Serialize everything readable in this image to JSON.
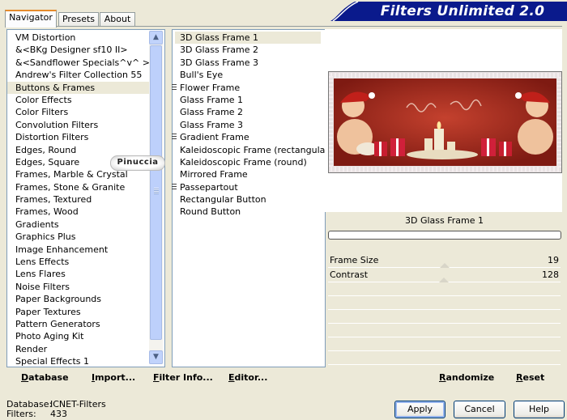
{
  "tabs": [
    "Navigator",
    "Presets",
    "About"
  ],
  "banner_title": "Filters Unlimited 2.0",
  "categories": [
    "VM Distortion",
    "&<BKg Designer sf10 II>",
    "&<Sandflower Specials^v^ >",
    "Andrew's Filter Collection 55",
    "Buttons & Frames",
    "Color Effects",
    "Color Filters",
    "Convolution Filters",
    "Distortion Filters",
    "Edges, Round",
    "Edges, Square",
    "Frames, Marble & Crystal",
    "Frames, Stone & Granite",
    "Frames, Textured",
    "Frames, Wood",
    "Gradients",
    "Graphics Plus",
    "Image Enhancement",
    "Lens Effects",
    "Lens Flares",
    "Noise Filters",
    "Paper Backgrounds",
    "Paper Textures",
    "Pattern Generators",
    "Photo Aging Kit",
    "Render",
    "Special Effects 1"
  ],
  "selected_category": "Buttons & Frames",
  "filters": [
    "3D Glass Frame 1",
    "3D Glass Frame 2",
    "3D Glass Frame 3",
    "Bull's Eye",
    "Flower Frame",
    "Glass Frame 1",
    "Glass Frame 2",
    "Glass Frame 3",
    "Gradient Frame",
    "Kaleidoscopic Frame (rectangular)",
    "Kaleidoscopic Frame (round)",
    "Mirrored Frame",
    "Passepartout",
    "Rectangular Button",
    "Round Button"
  ],
  "selected_filter": "3D Glass Frame 1",
  "filter_markers": [
    "Flower Frame",
    "Gradient Frame",
    "Passepartout"
  ],
  "badge_text": "Pinuccia",
  "preview": {
    "filter_name": "3D Glass Frame 1",
    "progress_fraction": 0.0
  },
  "params": [
    {
      "label": "Frame Size",
      "value": "19"
    },
    {
      "label": "Contrast",
      "value": "128"
    }
  ],
  "link_bar": {
    "database": "Database",
    "import": "Import...",
    "filter_info": "Filter Info...",
    "editor": "Editor..."
  },
  "right_bar": {
    "randomize": "Randomize",
    "reset": "Reset"
  },
  "status": {
    "database_label": "Database:",
    "database_value": "ICNET-Filters",
    "filters_label": "Filters:",
    "filters_value": "433"
  },
  "buttons": {
    "apply": "Apply",
    "cancel": "Cancel",
    "help": "Help"
  },
  "colors": {
    "banner": "#0a1a8c",
    "tab_highlight": "#e68b2c",
    "panel_bg": "#ece9d8",
    "preview_red": "#a3261a"
  },
  "icons": {
    "scroll_up": "chevron-up-icon",
    "scroll_down": "chevron-down-icon"
  }
}
